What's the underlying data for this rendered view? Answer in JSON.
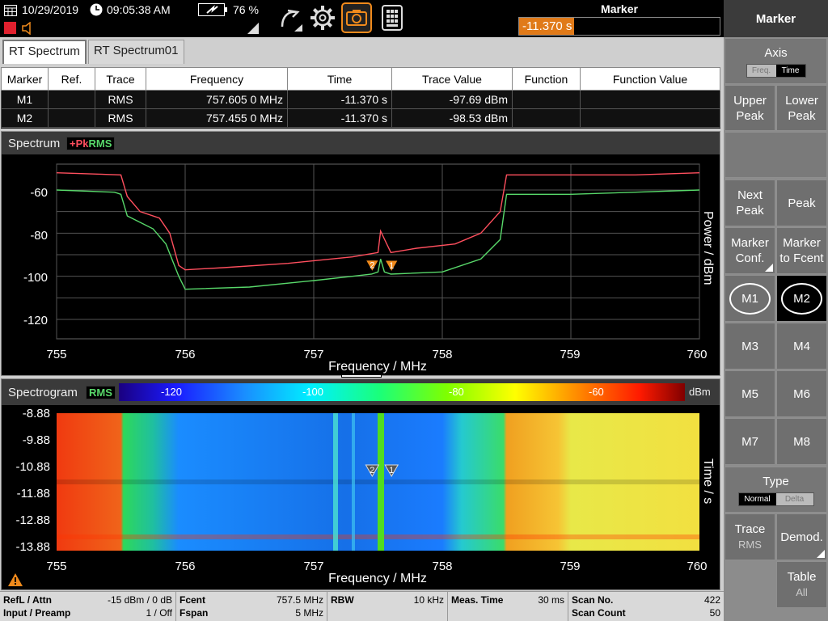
{
  "topbar": {
    "date": "10/29/2019",
    "time": "09:05:38 AM",
    "battery_pct": "76 %",
    "marker_title": "Marker",
    "marker_readout": "-11.370 s"
  },
  "tabs": [
    "RT Spectrum",
    "RT Spectrum01"
  ],
  "marker_table": {
    "headers": [
      "Marker",
      "Ref.",
      "Trace",
      "Frequency",
      "Time",
      "Trace Value",
      "Function",
      "Function Value"
    ],
    "rows": [
      [
        "M1",
        "",
        "RMS",
        "757.605 0 MHz",
        "-11.370 s",
        "-97.69 dBm",
        "",
        ""
      ],
      [
        "M2",
        "",
        "RMS",
        "757.455 0 MHz",
        "-11.370 s",
        "-98.53 dBm",
        "",
        ""
      ]
    ]
  },
  "spectrum": {
    "title": "Spectrum",
    "trace_pk": "+Pk",
    "trace_rms": "RMS",
    "ylabel": "Power / dBm",
    "xlabel": "Frequency / MHz",
    "yticks": [
      "-60",
      "-80",
      "-100",
      "-120"
    ],
    "xticks": [
      "755",
      "756",
      "757",
      "758",
      "759",
      "760"
    ]
  },
  "chart_data": {
    "type": "line",
    "xlabel": "Frequency / MHz",
    "ylabel": "Power / dBm",
    "xlim": [
      755,
      760
    ],
    "ylim": [
      -129,
      -48
    ],
    "grid": true,
    "series": [
      {
        "name": "+Pk",
        "color": "#ff4f5e",
        "x": [
          755.0,
          755.5,
          755.55,
          755.65,
          755.8,
          755.88,
          755.95,
          756.0,
          756.3,
          756.8,
          757.3,
          757.5,
          757.52,
          757.56,
          757.6,
          757.8,
          758.1,
          758.3,
          758.45,
          758.5,
          758.6,
          759.0,
          759.5,
          760.0
        ],
        "y": [
          -52,
          -53,
          -63,
          -70,
          -73,
          -80,
          -95,
          -97,
          -96,
          -94,
          -91,
          -89,
          -79,
          -84,
          -89,
          -87,
          -85,
          -80,
          -70,
          -53,
          -53,
          -53,
          -53,
          -52
        ]
      },
      {
        "name": "RMS",
        "color": "#58d86a",
        "x": [
          755.0,
          755.45,
          755.5,
          755.55,
          755.75,
          755.85,
          755.95,
          756.0,
          756.5,
          757.0,
          757.3,
          757.45,
          757.5,
          757.52,
          757.55,
          757.6,
          758.0,
          758.3,
          758.45,
          758.5,
          758.6,
          759.0,
          759.5,
          760.0
        ],
        "y": [
          -60,
          -61,
          -62,
          -72,
          -78,
          -85,
          -100,
          -106,
          -105,
          -102,
          -100,
          -99,
          -98,
          -92,
          -98,
          -99,
          -98,
          -92,
          -83,
          -62,
          -62,
          -62,
          -61,
          -60
        ]
      }
    ],
    "markers": [
      {
        "label": "1",
        "x": 757.605
      },
      {
        "label": "2",
        "x": 757.455
      }
    ]
  },
  "spectrogram": {
    "title": "Spectrogram",
    "trace": "RMS",
    "unit": "dBm",
    "colorbar_ticks": [
      "-120",
      "-100",
      "-80",
      "-60"
    ],
    "yticks": [
      "-8.88",
      "-9.88",
      "-10.88",
      "-11.88",
      "-12.88",
      "-13.88"
    ],
    "xticks": [
      "755",
      "756",
      "757",
      "758",
      "759",
      "760"
    ],
    "xlabel": "Frequency / MHz",
    "ylabel": "Time / s"
  },
  "status": {
    "refl_k": "RefL / Attn",
    "refl_v": "-15 dBm / 0 dB",
    "inp_k": "Input / Preamp",
    "inp_v": "1 / Off",
    "fcent_k": "Fcent",
    "fcent_v": "757.5 MHz",
    "fspan_k": "Fspan",
    "fspan_v": "5 MHz",
    "rbw_k": "RBW",
    "rbw_v": "10 kHz",
    "meas_k": "Meas. Time",
    "meas_v": "30 ms",
    "scan_k": "Scan No.",
    "scan_v": "422",
    "count_k": "Scan Count",
    "count_v": "50"
  },
  "sidebar": {
    "title": "Marker",
    "axis": "Axis",
    "freq": "Freq.",
    "time": "Time",
    "upper_peak": [
      "Upper",
      "Peak"
    ],
    "lower_peak": [
      "Lower",
      "Peak"
    ],
    "next_peak": [
      "Next",
      "Peak"
    ],
    "peak": "Peak",
    "marker_conf": [
      "Marker",
      "Conf."
    ],
    "marker_fcent": [
      "Marker",
      "to Fcent"
    ],
    "m": [
      "M1",
      "M2",
      "M3",
      "M4",
      "M5",
      "M6",
      "M7",
      "M8"
    ],
    "type": "Type",
    "normal": "Normal",
    "delta": "Delta",
    "trace": "Trace",
    "trace_val": "RMS",
    "demod": "Demod.",
    "table": "Table",
    "table_val": "All"
  }
}
